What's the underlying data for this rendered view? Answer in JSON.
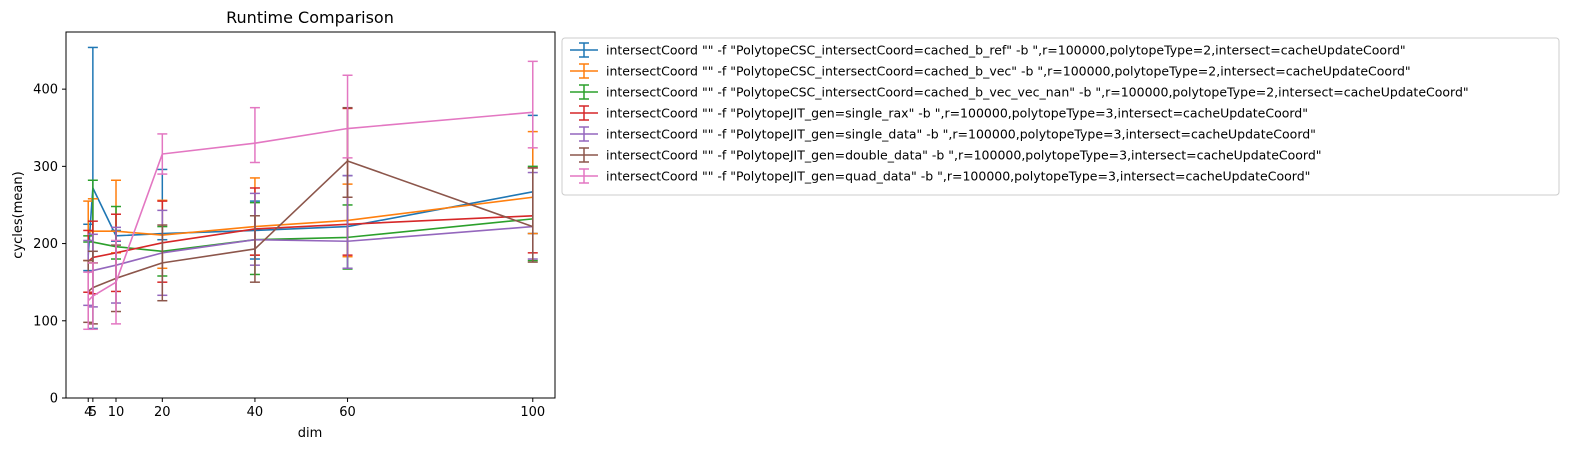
{
  "chart_data": {
    "type": "line",
    "title": "Runtime Comparison",
    "xlabel": "dim",
    "ylabel": "cycles(mean)",
    "x": [
      4,
      5,
      10,
      20,
      40,
      60,
      100
    ],
    "x_ticks": [
      4,
      5,
      10,
      20,
      40,
      60,
      100
    ],
    "y_ticks": [
      0,
      100,
      200,
      300,
      400
    ],
    "xlim": [
      -0.8,
      104.8
    ],
    "ylim": [
      0,
      474
    ],
    "grid": false,
    "legend_placement": "outside-top-right",
    "series": [
      {
        "name": "intersectCoord \"\" -f \"PolytopeCSC_intersectCoord=cached_b_ref\" -b \",r=100000,polytopeType=2,intersect=cacheUpdateCoord\"",
        "color": "#1f77b4",
        "values": [
          185,
          272,
          210,
          213,
          217,
          222,
          267
        ],
        "err_low": [
          165,
          90,
          203,
          205,
          180,
          168,
          213
        ],
        "err_high": [
          225,
          454,
          217,
          296,
          255,
          288,
          366
        ]
      },
      {
        "name": "intersectCoord \"\" -f \"PolytopeCSC_intersectCoord=cached_b_vec\" -b \",r=100000,polytopeType=2,intersect=cacheUpdateCoord\"",
        "color": "#ff7f0e",
        "values": [
          215,
          216,
          216,
          211,
          222,
          230,
          260
        ],
        "err_low": [
          178,
          175,
          188,
          168,
          185,
          183,
          213
        ],
        "err_high": [
          255,
          258,
          282,
          256,
          285,
          277,
          345
        ]
      },
      {
        "name": "intersectCoord \"\" -f \"PolytopeCSC_intersectCoord=cached_b_vec_vec_nan\" -b \",r=100000,polytopeType=2,intersect=cacheUpdateCoord\"",
        "color": "#2ca02c",
        "values": [
          206,
          202,
          196,
          190,
          205,
          208,
          232
        ],
        "err_low": [
          202,
          175,
          180,
          158,
          160,
          167,
          178
        ],
        "err_high": [
          210,
          282,
          248,
          222,
          253,
          250,
          300
        ]
      },
      {
        "name": "intersectCoord \"\" -f \"PolytopeJIT_gen=single_rax\" -b \",r=100000,polytopeType=3,intersect=cacheUpdateCoord\"",
        "color": "#d62728",
        "values": [
          177,
          182,
          188,
          201,
          219,
          225,
          236
        ],
        "err_low": [
          137,
          135,
          138,
          150,
          185,
          185,
          188
        ],
        "err_high": [
          217,
          229,
          238,
          255,
          272,
          375,
          298
        ]
      },
      {
        "name": "intersectCoord \"\" -f \"PolytopeJIT_gen=single_data\" -b \",r=100000,polytopeType=3,intersect=cacheUpdateCoord\"",
        "color": "#9467bd",
        "values": [
          162,
          165,
          172,
          188,
          205,
          203,
          222
        ],
        "err_low": [
          120,
          118,
          123,
          133,
          172,
          168,
          180
        ],
        "err_high": [
          204,
          212,
          221,
          243,
          265,
          288,
          292
        ]
      },
      {
        "name": "intersectCoord \"\" -f \"PolytopeJIT_gen=double_data\" -b \",r=100000,polytopeType=3,intersect=cacheUpdateCoord\"",
        "color": "#8c564b",
        "values": [
          138,
          143,
          155,
          175,
          193,
          307,
          222
        ],
        "err_low": [
          98,
          96,
          112,
          126,
          150,
          260,
          176
        ],
        "err_high": [
          178,
          190,
          198,
          224,
          236,
          376,
          298
        ]
      },
      {
        "name": "intersectCoord \"\" -f \"PolytopeJIT_gen=quad_data\" -b \",r=100000,polytopeType=3,intersect=cacheUpdateCoord\"",
        "color": "#e377c2",
        "values": [
          126,
          132,
          150,
          316,
          330,
          349,
          370
        ],
        "err_low": [
          89,
          89,
          96,
          290,
          305,
          311,
          324
        ],
        "err_high": [
          163,
          175,
          204,
          342,
          376,
          418,
          436
        ]
      }
    ]
  }
}
